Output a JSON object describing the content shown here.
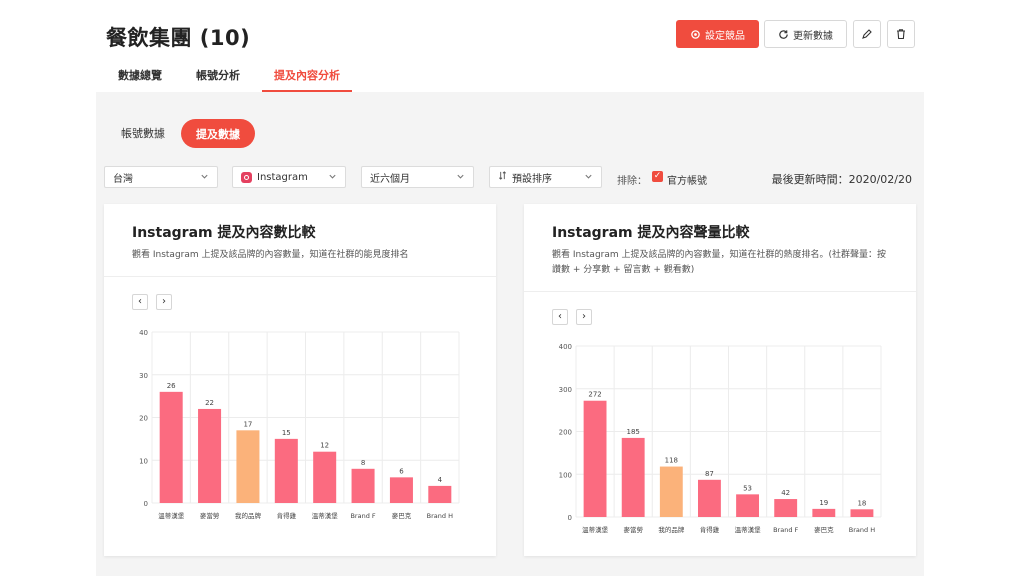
{
  "header": {
    "title": "餐飲集團 (10)",
    "settings_label": "設定競品",
    "refresh_label": "更新數據"
  },
  "tabs": [
    {
      "label": "數據總覽",
      "active": false
    },
    {
      "label": "帳號分析",
      "active": false
    },
    {
      "label": "提及內容分析",
      "active": true
    }
  ],
  "subtabs": {
    "account_data": "帳號數據",
    "mention_data": "提及數據"
  },
  "filters": {
    "region": "台灣",
    "platform": "Instagram",
    "period": "近六個月",
    "sort": "預設排序",
    "exclude_label": "排除：",
    "official_accounts": "官方帳號",
    "last_updated": "最後更新時間：2020/02/20"
  },
  "colors": {
    "accent": "#f04c3e",
    "bar": "#fb6b80",
    "highlight_bar": "#fbb27a"
  },
  "cards": [
    {
      "title": "Instagram 提及內容數比較",
      "description": "觀看 Instagram 上提及該品牌的內容數量，知道在社群的能見度排名"
    },
    {
      "title": "Instagram 提及內容聲量比較",
      "description": "觀看 Instagram 上提及該品牌的內容數量，知道在社群的熱度排名。(社群聲量：按讚數 + 分享數 + 留言數 + 觀看數)"
    }
  ],
  "chart_data": [
    {
      "type": "bar",
      "categories": [
        "溫蒂漢堡",
        "麥當勞",
        "我的品牌",
        "肯得雞",
        "溫蒂漢堡",
        "Brand F",
        "麥巴克",
        "Brand H"
      ],
      "values": [
        26,
        22,
        17,
        15,
        12,
        8,
        6,
        4
      ],
      "highlight_index": 2,
      "ylim": [
        0,
        40
      ],
      "yticks": [
        0,
        10,
        20,
        30,
        40
      ],
      "grid": true
    },
    {
      "type": "bar",
      "categories": [
        "溫蒂漢堡",
        "麥當勞",
        "我的品牌",
        "肯得雞",
        "溫蒂漢堡",
        "Brand F",
        "麥巴克",
        "Brand H"
      ],
      "values": [
        272,
        185,
        118,
        87,
        53,
        42,
        19,
        18
      ],
      "highlight_index": 2,
      "ylim": [
        0,
        400
      ],
      "yticks": [
        0,
        100,
        200,
        300,
        400
      ],
      "grid": true
    }
  ]
}
